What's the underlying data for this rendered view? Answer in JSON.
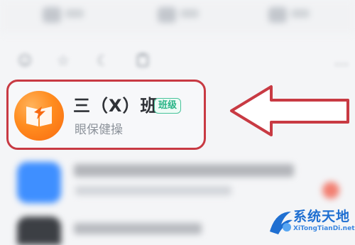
{
  "item": {
    "title": "三（X）班",
    "badge": "班级",
    "subtitle": "眼保健操"
  },
  "icons": {
    "toolbar": [
      "toolbar-icon",
      "toolbar-icon",
      "toolbar-icon",
      "toolbar-icon"
    ],
    "filter_row": [
      "emoji-icon",
      "star-icon",
      "moon-icon",
      "clipboard-icon"
    ],
    "avatar": "book-icon",
    "pointer": "arrow-left-icon"
  },
  "colors": {
    "highlight_border": "#c83a43",
    "avatar_orange": "#ff8c1f",
    "badge_green": "#28b486",
    "second_item_blue": "#3f8fff"
  },
  "watermark": {
    "name": "系统天地",
    "url": "XiTongTianDi.net"
  }
}
